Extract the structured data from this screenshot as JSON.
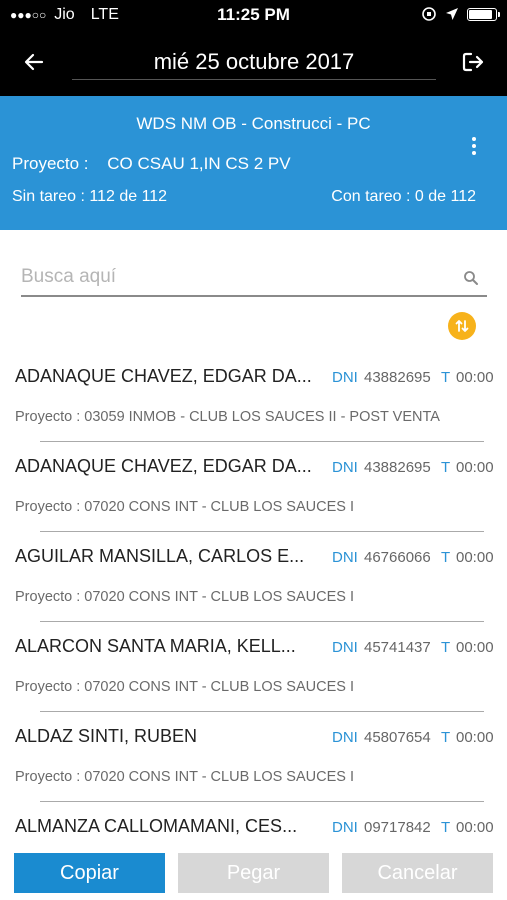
{
  "status_bar": {
    "signal_dots": "●●●○○",
    "carrier": "Jio",
    "network": "LTE",
    "time": "11:25 PM",
    "battery_level": 0.9
  },
  "appbar": {
    "date": "mié 25 octubre 2017",
    "back_icon": "arrow-left-icon",
    "logout_icon": "logout-icon"
  },
  "info": {
    "title": "WDS NM OB - Construcci - PC",
    "proyecto_label": "Proyecto :",
    "proyecto_value": "CO CSAU 1,IN CS 2 PV",
    "sin_tareo": "Sin tareo : 112 de 112",
    "con_tareo": "Con tareo : 0 de 112"
  },
  "search": {
    "placeholder": "Busca aquí"
  },
  "labels": {
    "dni": "DNI",
    "t": "T"
  },
  "workers": [
    {
      "name": "ADANAQUE CHAVEZ, EDGAR DA...",
      "dni": "43882695",
      "t": "00:00",
      "proyecto": "Proyecto : 03059 INMOB - CLUB LOS SAUCES II - POST VENTA"
    },
    {
      "name": "ADANAQUE CHAVEZ, EDGAR DA...",
      "dni": "43882695",
      "t": "00:00",
      "proyecto": "Proyecto : 07020 CONS INT - CLUB LOS SAUCES I"
    },
    {
      "name": "AGUILAR MANSILLA, CARLOS E...",
      "dni": "46766066",
      "t": "00:00",
      "proyecto": "Proyecto : 07020 CONS INT - CLUB LOS SAUCES I"
    },
    {
      "name": "ALARCON SANTA MARIA, KELL...",
      "dni": "45741437",
      "t": "00:00",
      "proyecto": "Proyecto : 07020 CONS INT - CLUB LOS SAUCES I"
    },
    {
      "name": "ALDAZ SINTI, RUBEN",
      "dni": "45807654",
      "t": "00:00",
      "proyecto": "Proyecto : 07020 CONS INT - CLUB LOS SAUCES I"
    },
    {
      "name": "ALMANZA CALLOMAMANI, CES...",
      "dni": "09717842",
      "t": "00:00",
      "proyecto": ""
    }
  ],
  "footer": {
    "copiar": "Copiar",
    "pegar": "Pegar",
    "cancelar": "Cancelar"
  },
  "colors": {
    "accent": "#2b93d6",
    "primary_button": "#1a8bd0",
    "disabled_button": "#d7d7d7",
    "sort_button": "#f7b21b"
  }
}
